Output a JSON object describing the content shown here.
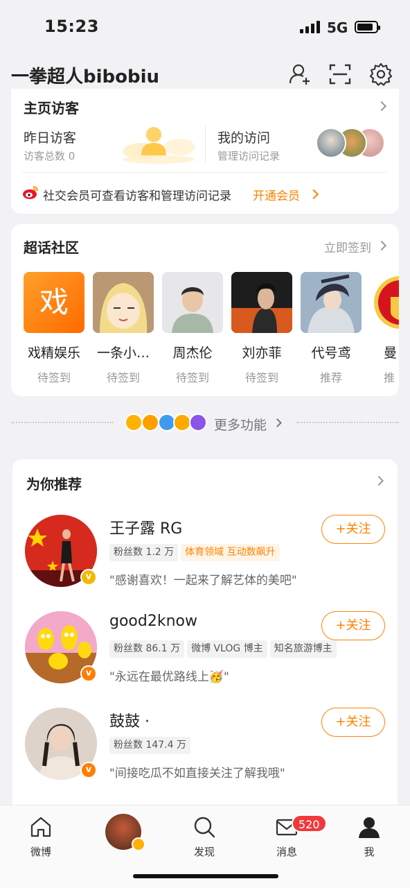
{
  "status_bar": {
    "time": "15:23",
    "network": "5G"
  },
  "header": {
    "title": "一拳超人bibobiu"
  },
  "visitors": {
    "title": "主页访客",
    "left_title": "昨日访客",
    "left_sub": "访客总数 0",
    "right_title": "我的访问",
    "right_sub": "管理访问记录",
    "banner_text": "社交会员可查看访客和管理访问记录",
    "banner_link": "开通会员"
  },
  "super_topic": {
    "title": "超话社区",
    "checkin": "立即签到",
    "items": [
      {
        "name": "戏精娱乐",
        "status": "待签到",
        "glyph": "戏"
      },
      {
        "name": "一条小…",
        "status": "待签到"
      },
      {
        "name": "周杰伦",
        "status": "待签到"
      },
      {
        "name": "刘亦菲",
        "status": "待签到"
      },
      {
        "name": "代号鸢",
        "status": "推荐"
      },
      {
        "name": "曼",
        "status": "推"
      }
    ]
  },
  "more_features": {
    "label": "更多功能"
  },
  "recommend": {
    "title": "为你推荐",
    "follow_label": "+关注",
    "users": [
      {
        "name": "王子露 RG",
        "tags": [
          {
            "text": "粉丝数 1.2 万",
            "style": "gray"
          },
          {
            "text": "体育领域 互动数飙升",
            "style": "orange"
          }
        ],
        "desc": "\"感谢喜欢！一起来了解艺体的美吧\"",
        "badge_color": "#f5b700"
      },
      {
        "name": "good2know",
        "tags": [
          {
            "text": "粉丝数 86.1 万",
            "style": "gray"
          },
          {
            "text": "微博 VLOG 博主",
            "style": "gray"
          },
          {
            "text": "知名旅游博主",
            "style": "gray"
          }
        ],
        "desc": "\"永远在最优路线上🥳\"",
        "badge_color": "#ff7d00"
      },
      {
        "name": "鼓鼓 ·",
        "tags": [
          {
            "text": "粉丝数 147.4 万",
            "style": "gray"
          }
        ],
        "desc": "\"间接吃瓜不如直接关注了解我哦\"",
        "badge_color": "#ff7d00"
      }
    ]
  },
  "tab_bar": {
    "items": [
      {
        "label": "微博"
      },
      {
        "label": ""
      },
      {
        "label": "发现"
      },
      {
        "label": "消息"
      },
      {
        "label": "我"
      }
    ],
    "message_badge": "520"
  }
}
